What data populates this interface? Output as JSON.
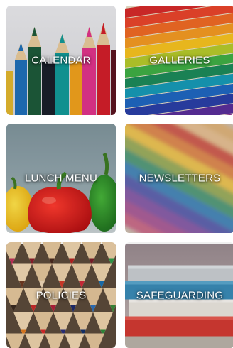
{
  "tiles": [
    {
      "id": "calendar",
      "label": "CALENDAR",
      "image": "colored-pencils-upright"
    },
    {
      "id": "galleries",
      "label": "GALLERIES",
      "image": "colored-pencils-diagonal"
    },
    {
      "id": "lunch_menu",
      "label": "LUNCH MENU",
      "image": "bell-peppers"
    },
    {
      "id": "newsletters",
      "label": "NEWSLETTERS",
      "image": "blurred-rainbow-pencils"
    },
    {
      "id": "policies",
      "label": "POLICIES",
      "image": "pencil-tips-pile"
    },
    {
      "id": "safeguarding",
      "label": "SAFEGUARDING",
      "image": "stacked-books"
    }
  ]
}
